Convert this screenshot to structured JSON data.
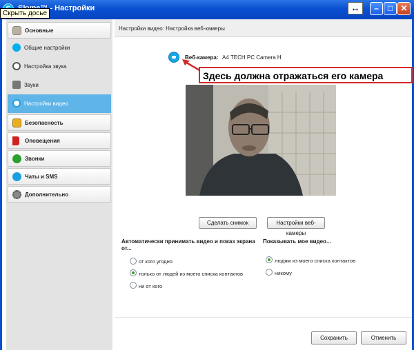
{
  "window": {
    "title": "Skype™ - Настройки",
    "tooltip": "Скрыть досье",
    "resize_glyph": "↔",
    "min_glyph": "–",
    "max_glyph": "□",
    "close_glyph": "✕"
  },
  "sidebar": {
    "categories": [
      {
        "label": "Основные",
        "icon": "general-icon"
      },
      {
        "label": "Безопасность",
        "icon": "lock-icon"
      },
      {
        "label": "Оповещения",
        "icon": "flag-icon"
      },
      {
        "label": "Звонки",
        "icon": "phone-icon"
      },
      {
        "label": "Чаты и SMS",
        "icon": "chat-icon"
      },
      {
        "label": "Дополнительно",
        "icon": "gear-icon"
      }
    ],
    "sub_items": [
      {
        "label": "Общие настройки",
        "icon": "skype-icon"
      },
      {
        "label": "Настройка звука",
        "icon": "headset-icon"
      },
      {
        "label": "Звуки",
        "icon": "speaker-icon"
      },
      {
        "label": "Настройки видео",
        "icon": "webcam-icon",
        "active": true
      }
    ]
  },
  "content": {
    "breadcrumb": "Настройки видео:  Настройка веб-камеры",
    "webcam_label": "Веб-камера:",
    "webcam_name": "A4 TECH PC Camera H",
    "annotation": "Здесь должна отражаться его камера",
    "snapshot_button": "Сделать снимок",
    "webcam_settings_button": "Настройки веб-камеры",
    "auto_accept_title": "Автоматически принимать видео и показ экрана от...",
    "auto_accept_options": [
      {
        "label": "от кого угодно",
        "checked": false
      },
      {
        "label": "только от людей из моего списка контактов",
        "checked": true
      },
      {
        "label": "ни от кого",
        "checked": false
      }
    ],
    "show_video_title": "Показывать мое видео...",
    "show_video_options": [
      {
        "label": "людям из моего списка контактов",
        "checked": true
      },
      {
        "label": "никому",
        "checked": false
      }
    ],
    "save_button": "Сохранить",
    "cancel_button": "Отменить"
  },
  "colors": {
    "titlebar": "#0a50d0",
    "active_item": "#5fb4e8",
    "annotation_border": "#d12b2b",
    "radio_checked": "#3c9a2e"
  }
}
